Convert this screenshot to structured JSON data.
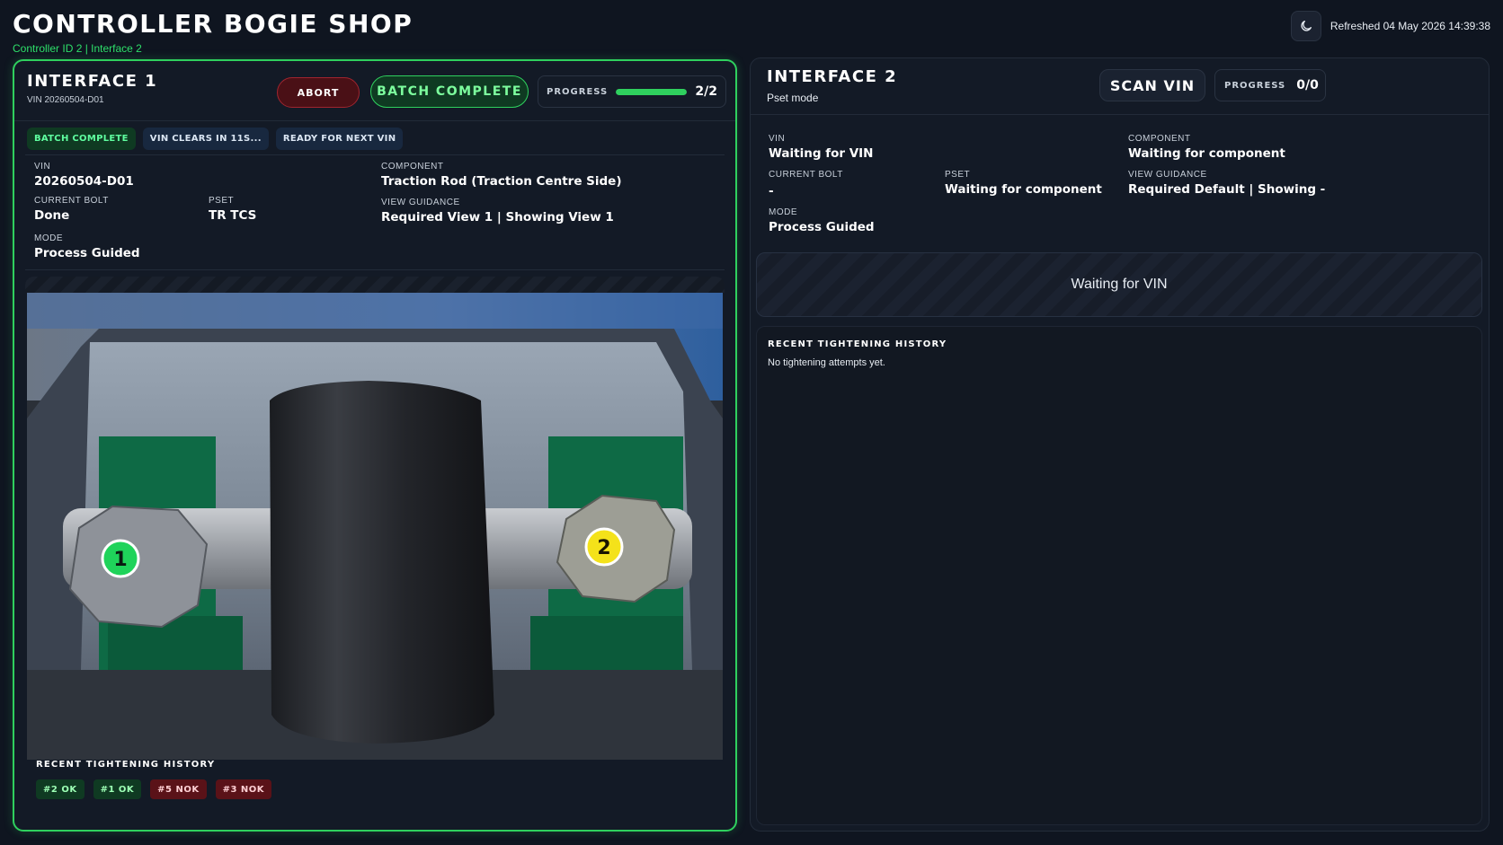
{
  "app": {
    "title": "CONTROLLER BOGIE SHOP",
    "subtitle": "Controller ID 2 |  Interface 2",
    "refreshed": "Refreshed 04 May 2026 14:39:38",
    "theme_icon": "moon-icon"
  },
  "interface1": {
    "title": "INTERFACE 1",
    "vin_sub": "VIN 20260504-D01",
    "abort_label": "ABORT",
    "batch_label": "BATCH COMPLETE",
    "progress_label": "PROGRESS",
    "progress_value": "2/2",
    "progress_fraction": 1.0,
    "chips": [
      "BATCH COMPLETE",
      "VIN CLEARS IN 11S...",
      "READY FOR NEXT VIN"
    ],
    "fields": {
      "vin_label": "VIN",
      "vin": "20260504-D01",
      "component_label": "COMPONENT",
      "component": "Traction Rod (Traction Centre Side)",
      "current_bolt_label": "CURRENT BOLT",
      "current_bolt": "Done",
      "pset_label": "PSET",
      "pset": "TR TCS",
      "view_guidance_label": "VIEW GUIDANCE",
      "view_guidance": "Required View 1  |  Showing View 1",
      "mode_label": "MODE",
      "mode": "Process Guided"
    },
    "bolt_markers": [
      {
        "number": "1",
        "status_color": "#1fd35a"
      },
      {
        "number": "2",
        "status_color": "#f4e21a"
      }
    ],
    "history_title": "RECENT TIGHTENING HISTORY",
    "history": [
      {
        "label": "#2  OK",
        "status": "ok"
      },
      {
        "label": "#1  OK",
        "status": "ok"
      },
      {
        "label": "#5  NOK",
        "status": "nok"
      },
      {
        "label": "#3  NOK",
        "status": "nok"
      }
    ]
  },
  "interface2": {
    "title": "INTERFACE 2",
    "subtitle": "Pset mode",
    "scan_label": "SCAN VIN",
    "progress_label": "PROGRESS",
    "progress_value": "0/0",
    "fields": {
      "vin_label": "VIN",
      "vin": "Waiting for VIN",
      "component_label": "COMPONENT",
      "component": "Waiting for component",
      "current_bolt_label": "CURRENT BOLT",
      "current_bolt": "-",
      "pset_label": "PSET",
      "pset": "Waiting for component",
      "view_guidance_label": "VIEW GUIDANCE",
      "view_guidance": "Required Default  |  Showing -",
      "mode_label": "MODE",
      "mode": "Process Guided"
    },
    "waiting_text": "Waiting for VIN",
    "history_title": "RECENT TIGHTENING HISTORY",
    "no_history": "No tightening attempts yet."
  },
  "colors": {
    "accent_green": "#2fd05e",
    "nok_red": "#5a1218",
    "background": "#0f1520"
  }
}
